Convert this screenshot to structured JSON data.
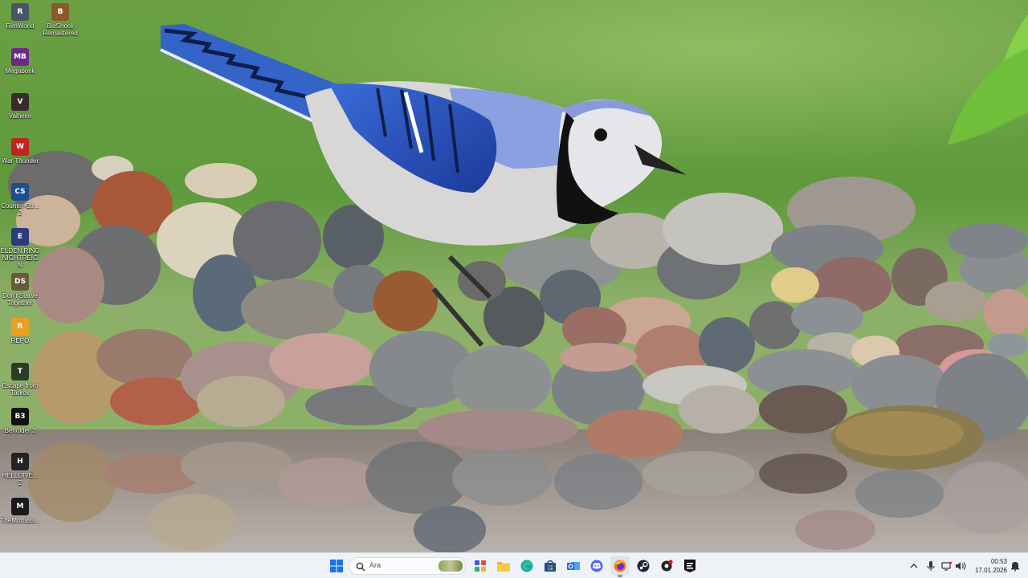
{
  "desktop": {
    "icons": [
      {
        "label": "RimWorld",
        "icon": "rimworld-icon",
        "color": "#4a5566"
      },
      {
        "label": "BioShock Remastered",
        "icon": "bioshock-icon",
        "color": "#8a5a2b"
      },
      {
        "label": "Megabonk",
        "icon": "megabonk-icon",
        "color": "#6a2a8a"
      },
      {
        "label": "Valheim",
        "icon": "valheim-icon",
        "color": "#3a2a2a"
      },
      {
        "label": "War Thunder",
        "icon": "war-thunder-icon",
        "color": "#c22222"
      },
      {
        "label": "Counter-Str... 2",
        "icon": "counter-strike-icon",
        "color": "#1d4f8f"
      },
      {
        "label": "ELDEN RING NIGHTREIGN",
        "icon": "elden-ring-icon",
        "color": "#2b3a7a"
      },
      {
        "label": "Don't Starve Together",
        "icon": "dont-starve-icon",
        "color": "#6a5a3a"
      },
      {
        "label": "REPO",
        "icon": "repo-icon",
        "color": "#e8a020"
      },
      {
        "label": "Escape from Tarkov",
        "icon": "tarkov-icon",
        "color": "#2e3a2a"
      },
      {
        "label": "Beholder 3",
        "icon": "beholder-icon",
        "color": "#111111"
      },
      {
        "label": "HELLDIVE... 2",
        "icon": "helldivers-icon",
        "color": "#222222"
      },
      {
        "label": "TheMortuss...",
        "icon": "mortuary-icon",
        "color": "#1a1a1a"
      }
    ]
  },
  "taskbar": {
    "search": {
      "placeholder": "Ara"
    },
    "apps": [
      {
        "name": "start-button",
        "icon": "windows-start-icon",
        "color": "#1a73e8"
      },
      {
        "name": "app-widget",
        "icon": "app-grid-icon",
        "color": "#3f5bd8"
      },
      {
        "name": "file-explorer",
        "icon": "folder-icon",
        "color": "#f3b52e"
      },
      {
        "name": "edge",
        "icon": "edge-icon",
        "color": "#1aa3c8"
      },
      {
        "name": "store",
        "icon": "store-icon",
        "color": "#1d4f8f"
      },
      {
        "name": "outlook",
        "icon": "outlook-icon",
        "color": "#2a6ad8"
      },
      {
        "name": "discord",
        "icon": "discord-icon",
        "color": "#5865f2"
      },
      {
        "name": "firefox",
        "icon": "firefox-icon",
        "color": "#ff7a1a"
      },
      {
        "name": "steam",
        "icon": "steam-icon",
        "color": "#1b2838"
      },
      {
        "name": "steam-notify",
        "icon": "steam-notify-icon",
        "color": "#222222"
      },
      {
        "name": "epic-games",
        "icon": "epic-games-icon",
        "color": "#111111"
      }
    ],
    "tray": {
      "time": "00:53",
      "date": "17.01.2026"
    }
  }
}
